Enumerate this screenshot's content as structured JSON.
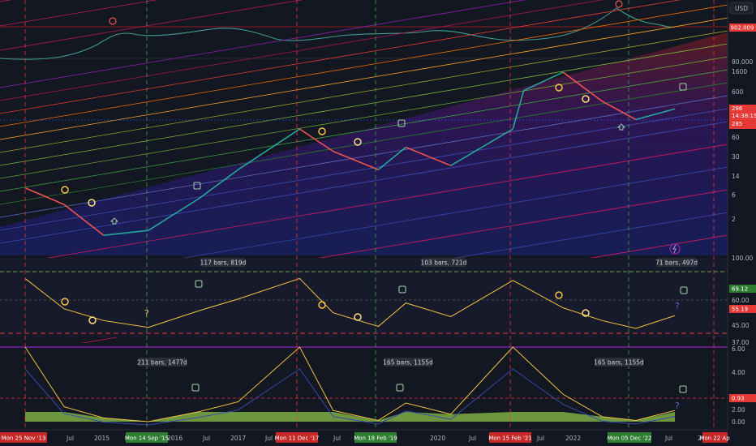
{
  "currency_button": "USD",
  "price_axis": {
    "top": [
      "80.000"
    ],
    "top_current": "902.009",
    "middle": [
      "1600",
      "600",
      "286",
      "200",
      "60",
      "30",
      "14",
      "6",
      "2"
    ],
    "middle_current": "286",
    "middle_countdown": "14:38:19",
    "middle_low": "285",
    "osc1": [
      "100.00",
      "69.12",
      "60.00",
      "55.19",
      "45.00",
      "37.00"
    ],
    "osc2": [
      "6.00",
      "4.00",
      "2.00",
      "0.93",
      "0.00"
    ]
  },
  "time_axis": {
    "labels": [
      "Jul",
      "2015",
      "Jul",
      "2016",
      "2017",
      "Jul",
      "Jul",
      "2020",
      "Jul",
      "2022",
      "Jul",
      "Jul",
      "202"
    ],
    "highlight_red": [
      "Mon 25 Nov '13",
      "Mon 11 Dec '17",
      "Mon 15 Feb '21",
      "Mon 22 Ap"
    ],
    "highlight_green": [
      "Mon 14 Sep '15",
      "Mon 18 Feb '19",
      "Mon 05 Dec '22"
    ]
  },
  "bar_counts": {
    "osc1": [
      "117 bars, 819d",
      "103 bars, 721d",
      "71 bars, 497d"
    ],
    "osc2": [
      "211 bars, 1477d",
      "165 bars, 1155d",
      "165 bars, 1155d"
    ]
  },
  "colors": {
    "background": "#131722",
    "price_up": "#26a69a",
    "price_down": "#ef5350",
    "oscillator": "#f5c542",
    "osc_fill": "#8bc34a",
    "blue_line": "#3f51b5",
    "red_badge": "#c62828",
    "green_badge": "#2e7d32",
    "value_badge": "#e53935",
    "green_value": "#2e7d32",
    "accent": "#9c27b0"
  },
  "chart_data": [
    {
      "type": "line",
      "scale": "log",
      "x": [
        "2013-11",
        "2014-06",
        "2015-01",
        "2015-09",
        "2016-06",
        "2017-01",
        "2017-12",
        "2018-06",
        "2019-02",
        "2019-07",
        "2020-03",
        "2021-02",
        "2021-04",
        "2021-11",
        "2022-06",
        "2022-12",
        "2023-07"
      ],
      "y": [
        1.5,
        0.8,
        0.25,
        0.3,
        1.0,
        3.0,
        14,
        6,
        3,
        7,
        3.5,
        14,
        60,
        120,
        40,
        20,
        30
      ]
    },
    {
      "type": "line",
      "ylim": [
        37,
        100
      ],
      "x": [
        "2013-11",
        "2014-06",
        "2015-01",
        "2015-09",
        "2016-06",
        "2017-01",
        "2017-12",
        "2018-06",
        "2019-02",
        "2019-07",
        "2020-03",
        "2021-02",
        "2021-11",
        "2022-06",
        "2022-12",
        "2023-07"
      ],
      "y": [
        93,
        62,
        50,
        43,
        60,
        72,
        93,
        58,
        44,
        68,
        54,
        91,
        63,
        50,
        42,
        55
      ]
    },
    {
      "type": "area",
      "ylim": [
        0,
        6
      ],
      "x": [
        "2013-11",
        "2014-06",
        "2015-01",
        "2015-09",
        "2016-06",
        "2017-01",
        "2017-12",
        "2018-06",
        "2019-02",
        "2019-07",
        "2020-03",
        "2021-02",
        "2021-11",
        "2022-06",
        "2022-12",
        "2023-07"
      ],
      "y": [
        6.0,
        1.2,
        0.3,
        0.0,
        0.8,
        1.6,
        6.0,
        0.9,
        0.1,
        1.5,
        0.6,
        6.0,
        2.2,
        0.4,
        0.1,
        0.9
      ]
    }
  ]
}
